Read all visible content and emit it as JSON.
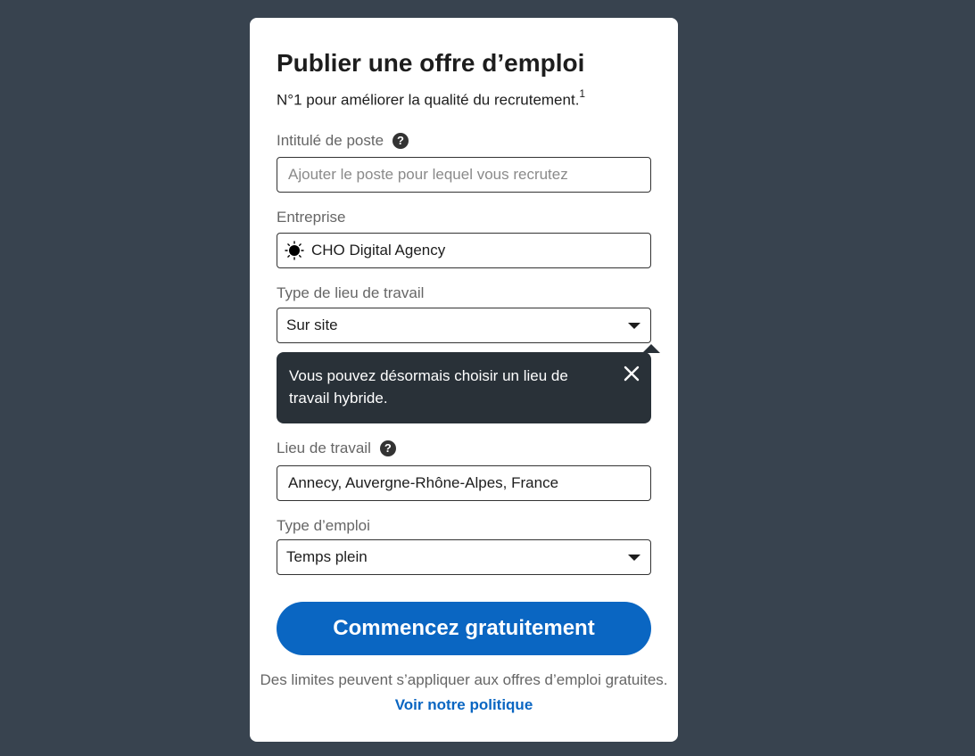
{
  "form": {
    "title": "Publier une offre d’emploi",
    "subtitle": "N°1 pour améliorer la qualité du recrutement.",
    "subtitle_footnote": "1",
    "job_title": {
      "label": "Intitulé de poste",
      "value": "",
      "placeholder": "Ajouter le poste pour lequel vous recrutez",
      "help_icon": "question-circle-icon"
    },
    "company": {
      "label": "Entreprise",
      "value": "CHO Digital Agency",
      "logo_icon": "company-sun-logo"
    },
    "workplace_type": {
      "label": "Type de lieu de travail",
      "selected": "Sur site",
      "icon": "caret-down-icon"
    },
    "tooltip": {
      "text": "Vous pouvez désormais choisir un lieu de travail hybride.",
      "close_icon": "close-icon"
    },
    "location": {
      "label": "Lieu de travail",
      "value": "Annecy, Auvergne-Rhône-Alpes, France",
      "help_icon": "question-circle-icon"
    },
    "employment_type": {
      "label": "Type d’emploi",
      "selected": "Temps plein",
      "icon": "caret-down-icon"
    },
    "cta_label": "Commencez gratuitement",
    "disclaimer": "Des limites peuvent s’appliquer aux offres d’emploi gratuites.",
    "policy_link": "Voir notre politique"
  },
  "colors": {
    "background": "#38434f",
    "card": "#ffffff",
    "primary": "#0a66c2",
    "tooltip": "#293138",
    "text": "#1d1d1d",
    "muted": "#666666"
  }
}
